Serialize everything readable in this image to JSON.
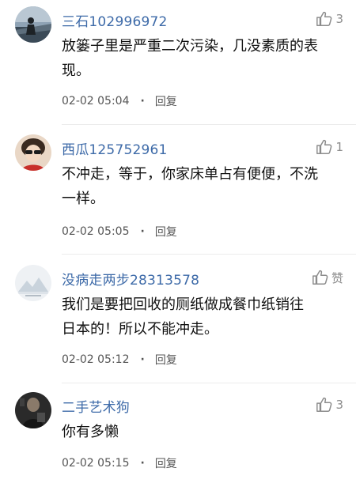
{
  "colors": {
    "username": "#3d6aa8",
    "meta": "#555555",
    "like": "#8c8c8c"
  },
  "comments": [
    {
      "username": "三石102996972",
      "like_icon": "thumbs-up-icon",
      "like_count": "3",
      "lines": [
        "放篓子里是严重二次污染，几没素质的表",
        "现。"
      ],
      "time": "02-02 05:04",
      "separator": "·",
      "reply": "回复"
    },
    {
      "username": "西瓜125752961",
      "like_icon": "thumbs-up-icon",
      "like_count": "1",
      "lines": [
        "不冲走，等于，你家床单占有便便，不洗",
        "一样。"
      ],
      "time": "02-02 05:05",
      "separator": "·",
      "reply": "回复"
    },
    {
      "username": "没病走两步28313578",
      "like_icon": "thumbs-up-icon",
      "like_count": "赞",
      "lines": [
        "我们是要把回收的厕纸做成餐巾纸销往",
        "日本的！所以不能冲走。"
      ],
      "time": "02-02 05:12",
      "separator": "·",
      "reply": "回复"
    },
    {
      "username": "二手艺术狗",
      "like_icon": "thumbs-up-icon",
      "like_count": "3",
      "lines": [
        "你有多懒"
      ],
      "time": "02-02 05:15",
      "separator": "·",
      "reply": "回复"
    }
  ]
}
